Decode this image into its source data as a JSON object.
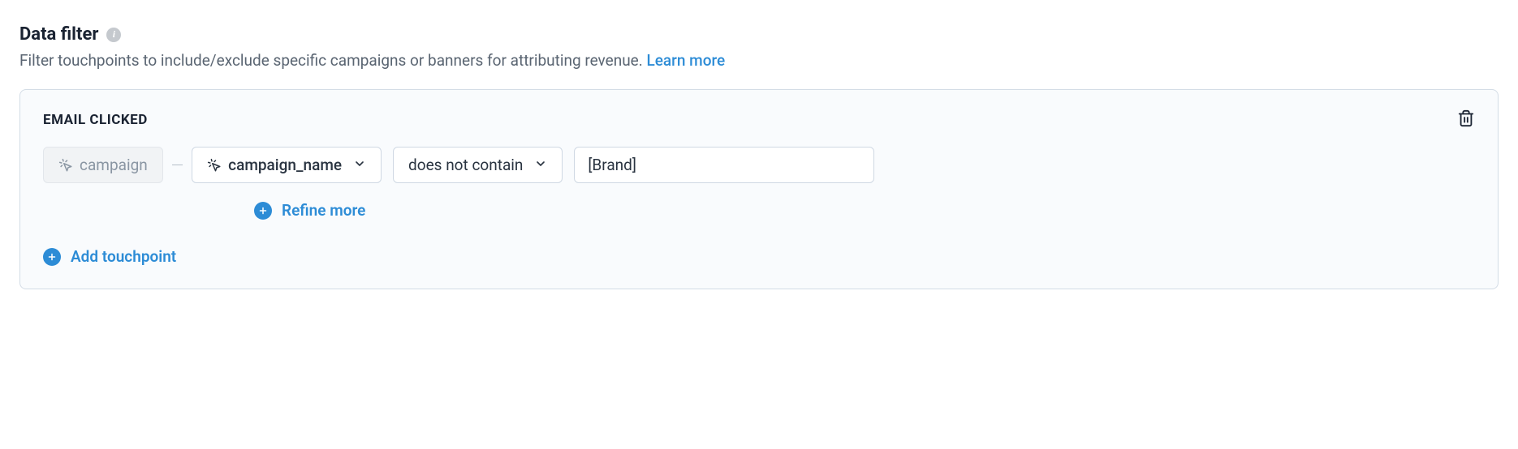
{
  "header": {
    "title": "Data filter",
    "description": "Filter touchpoints to include/exclude specific campaigns or banners for attributing revenue. ",
    "learn_more": "Learn more"
  },
  "filter": {
    "touchpoint_label": "EMAIL CLICKED",
    "source_chip": "campaign",
    "property_dropdown": "campaign_name",
    "operator_dropdown": "does not contain",
    "value": "[Brand]",
    "refine_label": "Refine more",
    "add_touchpoint_label": "Add touchpoint"
  }
}
